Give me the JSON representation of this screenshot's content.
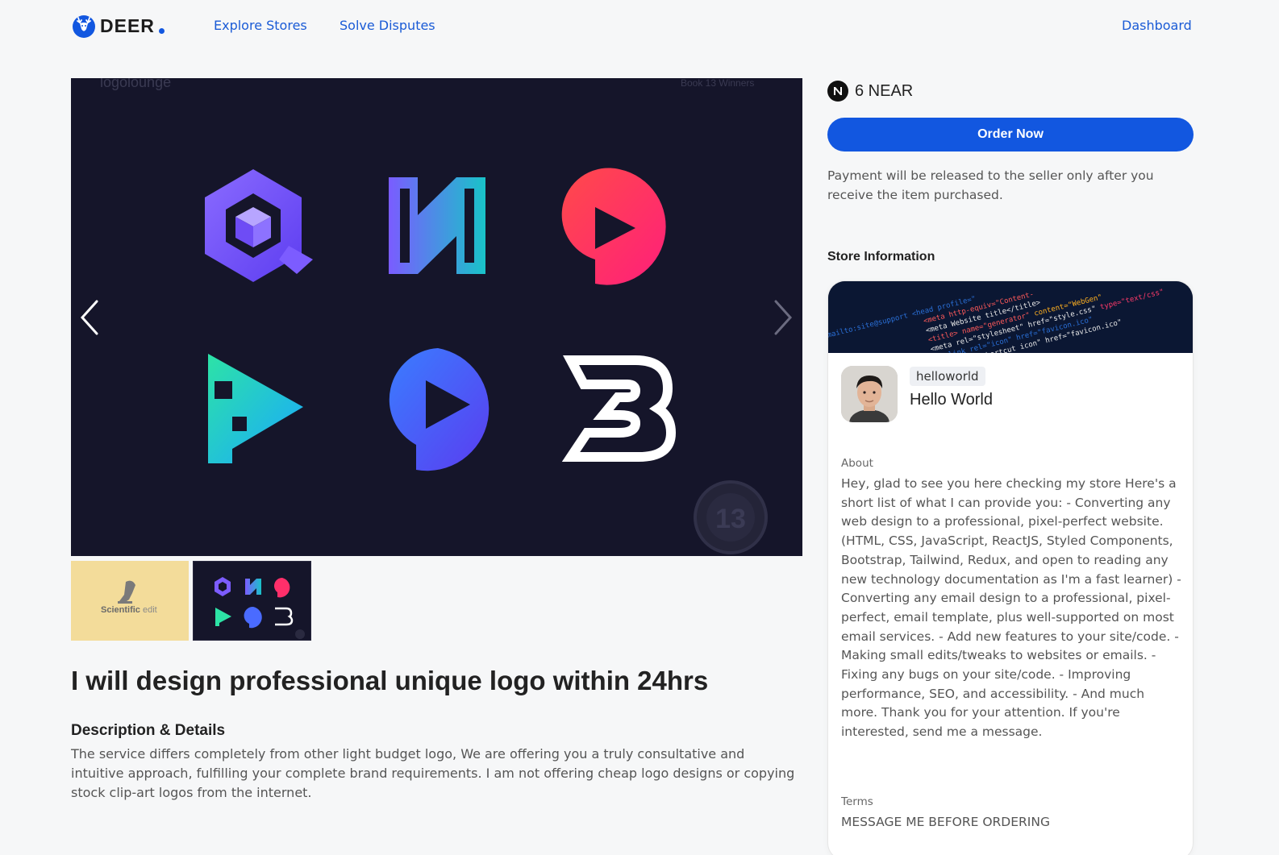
{
  "header": {
    "brand": "DEER",
    "nav": [
      "Explore Stores",
      "Solve Disputes"
    ],
    "dashboard": "Dashboard"
  },
  "gallery": {
    "watermark_left": "logolounge",
    "watermark_right": "Book 13 Winners",
    "badge_number": "13",
    "thumb1_text_a": "Scientific",
    "thumb1_text_b": "edit"
  },
  "listing": {
    "title": "I will design professional unique logo within 24hrs",
    "description_heading": "Description & Details",
    "description": "The service differs completely from other light budget logo, We are offering you a truly consultative and intuitive approach, fulfilling your complete brand requirements. I am not offering cheap logo designs or copying stock clip-art logos from the internet."
  },
  "purchase": {
    "price": "6 NEAR",
    "order_label": "Order Now",
    "payment_note": "Payment will be released to the seller only after you receive the item purchased."
  },
  "store": {
    "heading": "Store Information",
    "username": "helloworld",
    "name": "Hello World",
    "about_label": "About",
    "about": "Hey, glad to see you here checking my store Here's a short list of what I can provide you: - Converting any web design to a professional, pixel-perfect website. (HTML, CSS, JavaScript, ReactJS, Styled Components, Bootstrap, Tailwind, Redux, and open to reading any new technology documentation as I'm a fast learner) - Converting any email design to a professional, pixel-perfect, email template, plus well-supported on most email services. - Add new features to your site/code. - Making small edits/tweaks to websites or emails. - Fixing any bugs on your site/code. - Improving performance, SEO, and accessibility. - And much more. Thank you for your attention. If you're interested, send me a message.",
    "terms_label": "Terms",
    "terms": "MESSAGE ME BEFORE ORDERING"
  },
  "colors": {
    "accent": "#1257e0",
    "link": "#1a5bd6",
    "gallery_bg": "#15152a"
  }
}
